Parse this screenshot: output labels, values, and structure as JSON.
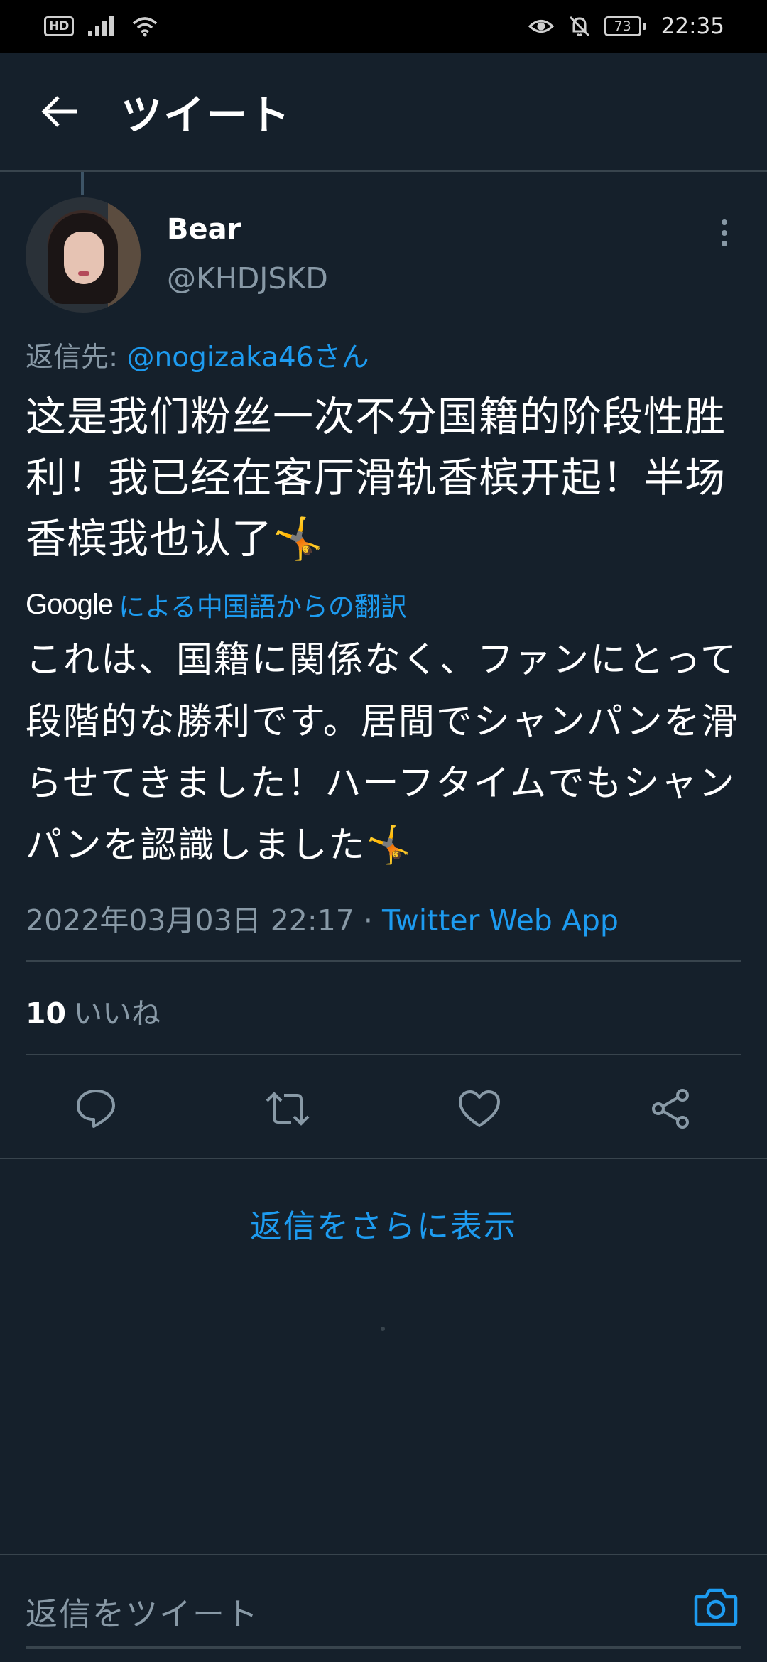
{
  "status_bar": {
    "hd_label": "HD",
    "battery": "73",
    "time": "22:35"
  },
  "header": {
    "title": "ツイート"
  },
  "tweet": {
    "author_name": "Bear",
    "author_handle": "@KHDJSKD",
    "reply_to_prefix": "返信先: ",
    "reply_to_mention": "@nogizaka46さん",
    "text": "这是我们粉丝一次不分国籍的阶段性胜利！我已经在客厅滑轨香槟开起！半场香槟我也认了🤸",
    "translation_brand": "Google",
    "translation_label": "による中国語からの翻訳",
    "translation": "これは、国籍に関係なく、ファンにとって段階的な勝利です。居間でシャンパンを滑らせてきました！ハーフタイムでもシャンパンを認識しました🤸",
    "datetime": "2022年03月03日 22:17",
    "separator": " · ",
    "source_app": "Twitter Web App",
    "like_count": "10",
    "like_label": "いいね"
  },
  "more_replies": "返信をさらに表示",
  "reply_bar": {
    "placeholder": "返信をツイート"
  },
  "colors": {
    "background": "#15202b",
    "accent": "#1d9bf0",
    "secondary_text": "#8899a6",
    "divider": "#38444d"
  }
}
